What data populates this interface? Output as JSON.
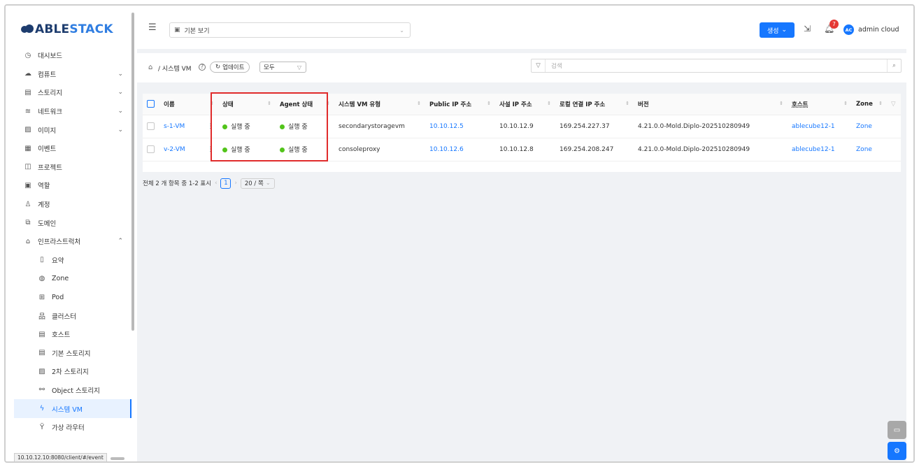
{
  "brand": {
    "part1": "ABLE",
    "part2": "STACK"
  },
  "sidebar": {
    "items": [
      {
        "label": "대시보드",
        "icon": "dashboard-icon",
        "glyph": "◷",
        "chev": ""
      },
      {
        "label": "컴퓨트",
        "icon": "cloud-icon",
        "glyph": "☁",
        "chev": "⌄"
      },
      {
        "label": "스토리지",
        "icon": "database-icon",
        "glyph": "▤",
        "chev": "⌄"
      },
      {
        "label": "네트워크",
        "icon": "wifi-icon",
        "glyph": "≋",
        "chev": "⌄"
      },
      {
        "label": "이미지",
        "icon": "picture-icon",
        "glyph": "▨",
        "chev": "⌄"
      },
      {
        "label": "이벤트",
        "icon": "schedule-icon",
        "glyph": "▦",
        "chev": ""
      },
      {
        "label": "프로젝트",
        "icon": "project-icon",
        "glyph": "◫",
        "chev": ""
      },
      {
        "label": "역할",
        "icon": "idcard-icon",
        "glyph": "▣",
        "chev": ""
      },
      {
        "label": "계정",
        "icon": "team-icon",
        "glyph": "♙",
        "chev": ""
      },
      {
        "label": "도메인",
        "icon": "block-icon",
        "glyph": "⧉",
        "chev": ""
      },
      {
        "label": "인프라스트럭처",
        "icon": "bank-icon",
        "glyph": "⌂",
        "chev": "⌃"
      }
    ],
    "subitems": [
      {
        "label": "요약",
        "icon": "read-icon",
        "glyph": "▯"
      },
      {
        "label": "Zone",
        "icon": "global-icon",
        "glyph": "◍"
      },
      {
        "label": "Pod",
        "icon": "appstore-icon",
        "glyph": "⊞"
      },
      {
        "label": "클러스터",
        "icon": "cluster-icon",
        "glyph": "品"
      },
      {
        "label": "호스트",
        "icon": "host-icon",
        "glyph": "▤"
      },
      {
        "label": "기본 스토리지",
        "icon": "primary-storage-icon",
        "glyph": "▤"
      },
      {
        "label": "2차 스토리지",
        "icon": "secondary-storage-icon",
        "glyph": "▨"
      },
      {
        "label": "Object 스토리지",
        "icon": "object-storage-icon",
        "glyph": "⚯"
      },
      {
        "label": "시스템 VM",
        "icon": "thunderbolt-icon",
        "glyph": "ϟ",
        "active": true
      },
      {
        "label": "가상 라우터",
        "icon": "fork-icon",
        "glyph": "Ÿ"
      }
    ]
  },
  "status_url": "10.10.12.10:8080/client/#/event",
  "topbar": {
    "view_label": "기본 보기",
    "create_label": "생성",
    "notification_count": "7",
    "avatar": "AC",
    "username": "admin cloud"
  },
  "crumb": {
    "path": "/ 시스템 VM",
    "refresh": "업데이트",
    "filter": "모두",
    "search_placeholder": "검색"
  },
  "table": {
    "columns": [
      "이름",
      "상태",
      "Agent 상태",
      "시스템 VM 유형",
      "Public IP 주소",
      "사설 IP 주소",
      "로컬 연결 IP 주소",
      "버전",
      "호스트",
      "Zone"
    ],
    "rows": [
      {
        "name": "s-1-VM",
        "state": "실행 중",
        "agent": "실행 중",
        "type": "secondarystoragevm",
        "public_ip": "10.10.12.5",
        "private_ip": "10.10.12.9",
        "link_ip": "169.254.227.37",
        "version": "4.21.0.0-Mold.Diplo-202510280949",
        "host": "ablecube12-1",
        "zone": "Zone"
      },
      {
        "name": "v-2-VM",
        "state": "실행 중",
        "agent": "실행 중",
        "type": "consoleproxy",
        "public_ip": "10.10.12.6",
        "private_ip": "10.10.12.8",
        "link_ip": "169.254.208.247",
        "version": "4.21.0.0-Mold.Diplo-202510280949",
        "host": "ablecube12-1",
        "zone": "Zone"
      }
    ],
    "status_color": "#52c41a"
  },
  "pager": {
    "summary": "전체 2 개 항목 중 1-2 표시",
    "page": "1",
    "size": "20 / 쪽"
  },
  "colors": {
    "accent": "#1677ff",
    "highlight": "#e02b2b",
    "brand": "#1d3c6e"
  }
}
